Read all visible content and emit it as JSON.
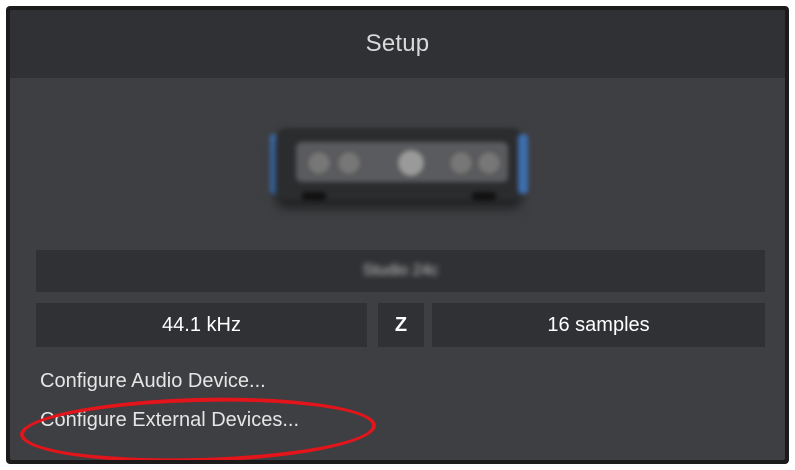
{
  "window": {
    "title": "Setup"
  },
  "device": {
    "image_icon": "audio-interface-icon",
    "name": "Studio 24c"
  },
  "settings": {
    "sample_rate": "44.1 kHz",
    "z_label": "Z",
    "buffer_size": "16 samples"
  },
  "links": {
    "configure_audio": "Configure Audio Device...",
    "configure_external": "Configure External Devices..."
  },
  "colors": {
    "panel_bg": "#3e3f42",
    "row_bg": "#303134",
    "accent_blue": "#3d6fae",
    "annotation_red": "#e4141b"
  }
}
